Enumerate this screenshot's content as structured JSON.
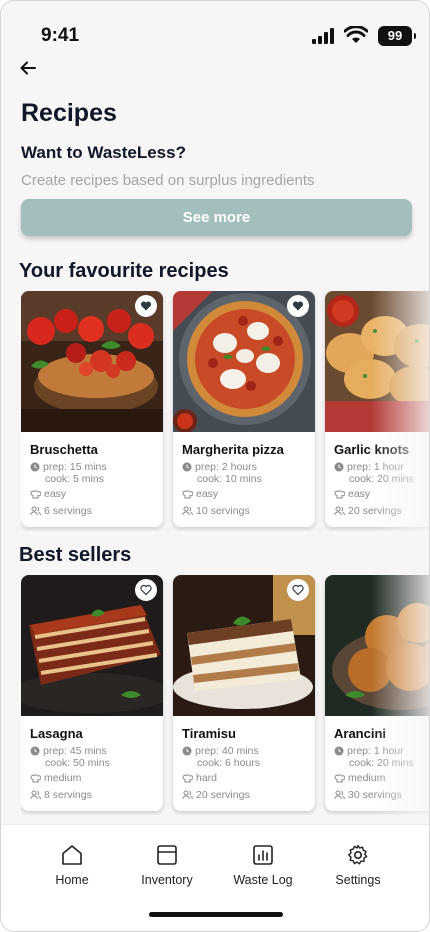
{
  "status": {
    "time": "9:41",
    "battery": "99"
  },
  "header": {
    "title": "Recipes",
    "subtitle": "Want to WasteLess?",
    "hint": "Create recipes based on surplus ingredients",
    "cta": "See more"
  },
  "sections": [
    {
      "title": "Your favourite recipes",
      "cards": [
        {
          "name": "Bruschetta",
          "prep": "prep: 15 mins",
          "cook": "cook: 5 mins",
          "difficulty": "easy",
          "servings": "6 servings",
          "favourite": true,
          "image": "bruschetta-photo"
        },
        {
          "name": "Margherita pizza",
          "prep": "prep: 2 hours",
          "cook": "cook: 10 mins",
          "difficulty": "easy",
          "servings": "10 servings",
          "favourite": true,
          "image": "pizza-photo"
        },
        {
          "name": "Garlic knots",
          "prep": "prep: 1 hour",
          "cook": "cook: 20 mins",
          "difficulty": "easy",
          "servings": "20 servings",
          "favourite": false,
          "image": "garlic-knots-photo"
        }
      ]
    },
    {
      "title": "Best sellers",
      "cards": [
        {
          "name": "Lasagna",
          "prep": "prep: 45 mins",
          "cook": "cook: 50 mins",
          "difficulty": "medium",
          "servings": "8 servings",
          "favourite": false,
          "image": "lasagna-photo"
        },
        {
          "name": "Tiramisu",
          "prep": "prep: 40 mins",
          "cook": "cook: 6 hours",
          "difficulty": "hard",
          "servings": "20 servings",
          "favourite": false,
          "image": "tiramisu-photo"
        },
        {
          "name": "Arancini",
          "prep": "prep: 1 hour",
          "cook": "cook: 20 mins",
          "difficulty": "medium",
          "servings": "30 servings",
          "favourite": false,
          "image": "arancini-photo"
        }
      ]
    }
  ],
  "tabs": [
    {
      "label": "Home",
      "icon": "home-icon"
    },
    {
      "label": "Inventory",
      "icon": "inventory-icon"
    },
    {
      "label": "Waste Log",
      "icon": "waste-log-icon"
    },
    {
      "label": "Settings",
      "icon": "settings-icon"
    }
  ],
  "colors": {
    "accent": "#a3bfbd",
    "background": "#f7f5f5",
    "text": "#0f172a",
    "muted": "#8a8a8a"
  }
}
